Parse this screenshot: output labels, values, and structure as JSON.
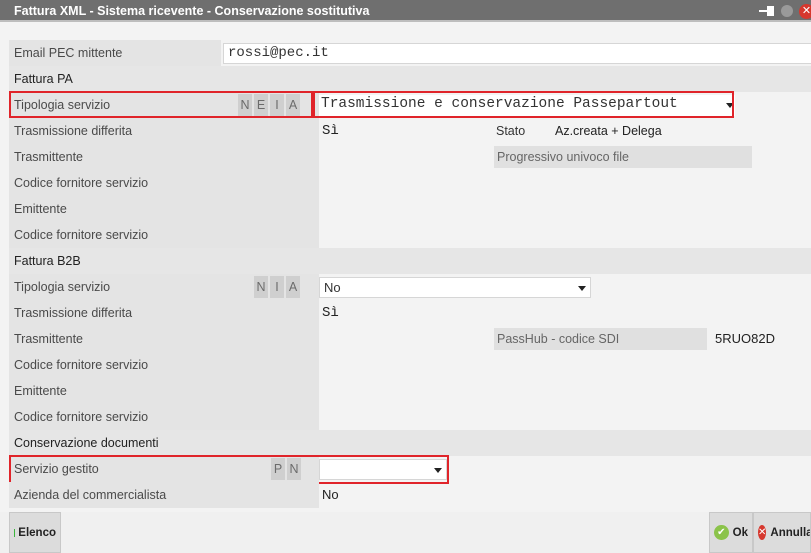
{
  "window": {
    "title": "Fattura XML - Sistema ricevente - Conservazione sostitutiva"
  },
  "email": {
    "label": "Email PEC mittente",
    "value": "rossi@pec.it"
  },
  "fattura_pa": {
    "section": "Fattura PA",
    "tipologia_label": "Tipologia servizio",
    "options": [
      "N",
      "E",
      "I",
      "A"
    ],
    "tipologia_value": "Trasmissione e conservazione Passepartout",
    "differita_label": "Trasmissione differita",
    "differita_value": "Sì",
    "stato_label": "Stato",
    "stato_value": "Az.creata + Delega",
    "trasmittente_label": "Trasmittente",
    "progressivo_label": "Progressivo univoco file",
    "codice1_label": "Codice fornitore servizio",
    "emittente_label": "Emittente",
    "codice2_label": "Codice fornitore servizio"
  },
  "fattura_b2b": {
    "section": "Fattura B2B",
    "tipologia_label": "Tipologia servizio",
    "options": [
      "N",
      "I",
      "A"
    ],
    "tipologia_value": "No",
    "differita_label": "Trasmissione differita",
    "differita_value": "Sì",
    "trasmittente_label": "Trasmittente",
    "passhub_label": "PassHub - codice SDI",
    "passhub_value": "5RUO82D",
    "codice1_label": "Codice fornitore servizio",
    "emittente_label": "Emittente",
    "codice2_label": "Codice fornitore servizio"
  },
  "conservazione": {
    "section": "Conservazione documenti",
    "servizio_label": "Servizio gestito",
    "options": [
      "P",
      "N"
    ],
    "servizio_value": "",
    "azienda_label": "Azienda del commercialista",
    "azienda_value": "No"
  },
  "buttons": {
    "elenco": "Elenco",
    "ok": "Ok",
    "annulla": "Annulla"
  },
  "colors": {
    "highlight": "#e0242a",
    "titlebar": "#6f6f6f"
  }
}
